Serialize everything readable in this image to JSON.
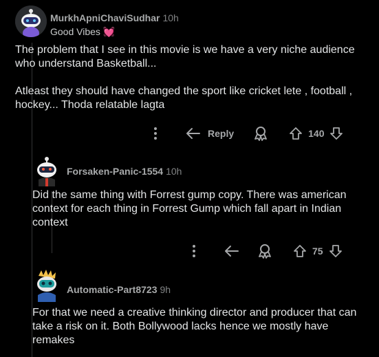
{
  "comments": [
    {
      "username": "MurkhApniChaviSudhar",
      "age": "10h",
      "flair_text": "Good Vibes",
      "flair_emoji": "💓",
      "body": [
        "The problem that I see in this movie is we have a very niche audience who understand Basketball...",
        "Atleast they should have changed the sport like cricket lete , football , hockey... Thoda relatable lagta"
      ],
      "reply_label": "Reply",
      "score": "140"
    },
    {
      "username": "Forsaken-Panic-1554",
      "age": "10h",
      "body": [
        "Did the same thing with Forrest gump copy. There was american context for each thing in Forrest Gump which fall apart in Indian context"
      ],
      "score": "75"
    },
    {
      "username": "Automatic-Part8723",
      "age": "9h",
      "body": [
        "For that we need a creative thinking director and producer that can take a risk on it. Both Bollywood lacks hence we mostly have remakes"
      ]
    }
  ],
  "icons": {
    "more": "more-options-icon",
    "reply": "reply-arrow-icon",
    "award": "award-icon",
    "upvote": "upvote-icon",
    "downvote": "downvote-icon"
  },
  "colors": {
    "background": "#000000",
    "text": "#e3e5e6",
    "muted": "#818384",
    "icon": "#a6a8aa",
    "thread_line": "#343536"
  }
}
